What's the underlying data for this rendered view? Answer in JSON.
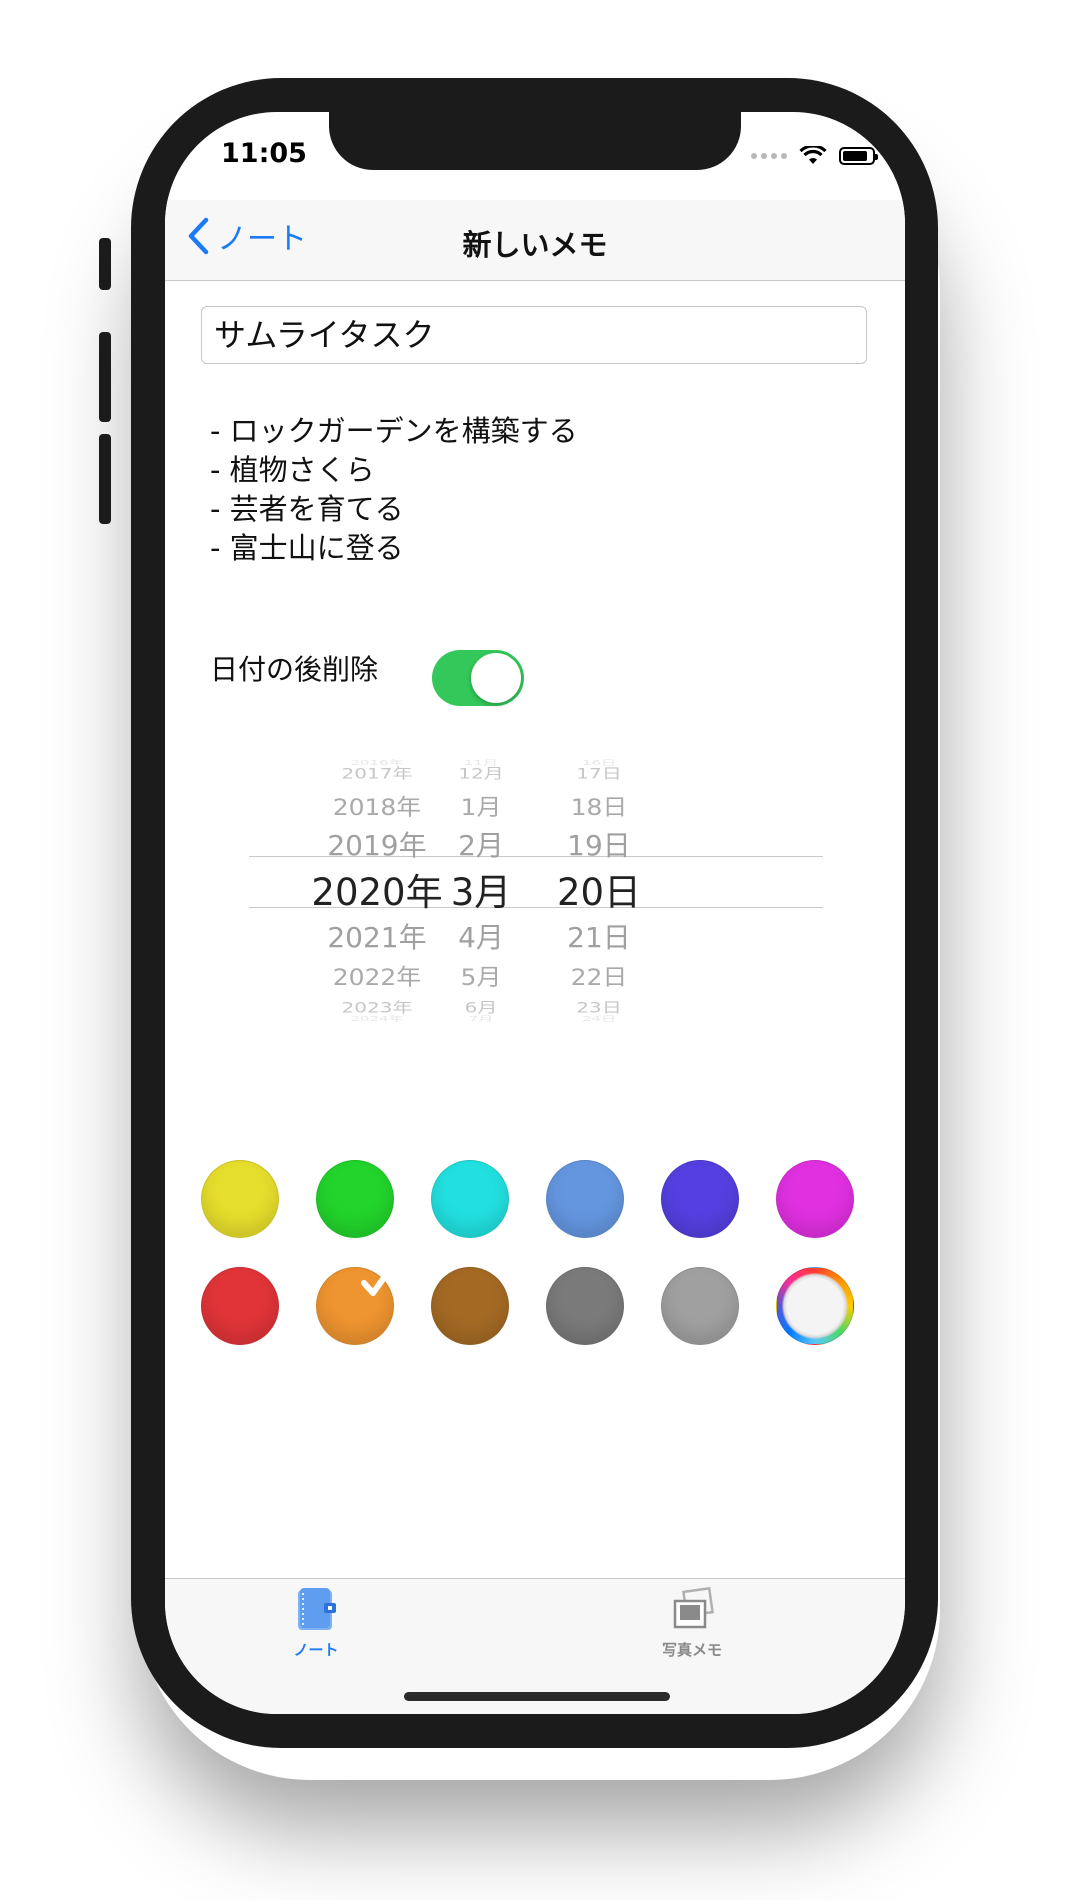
{
  "status": {
    "time": "11:05"
  },
  "nav": {
    "back_label": "ノート",
    "title": "新しいメモ"
  },
  "memo": {
    "title_value": "サムライタスク",
    "lines": [
      "- ロックガーデンを構築する",
      "- 植物さくら",
      "- 芸者を育てる",
      "- 富士山に登る"
    ]
  },
  "toggle": {
    "label": "日付の後削除",
    "on": true
  },
  "date_picker": {
    "years": [
      "2016年",
      "2017年",
      "2018年",
      "2019年",
      "2020年",
      "2021年",
      "2022年",
      "2023年",
      "2024年"
    ],
    "months": [
      "11月",
      "12月",
      "1月",
      "2月",
      "3月",
      "4月",
      "5月",
      "6月",
      "7月"
    ],
    "days": [
      "16日",
      "17日",
      "18日",
      "19日",
      "20日",
      "21日",
      "22日",
      "23日",
      "24日"
    ],
    "selected": {
      "year": "2020年",
      "month": "3月",
      "day": "20日"
    }
  },
  "colors": {
    "swatches": [
      {
        "name": "yellow",
        "color": "#e6de2c"
      },
      {
        "name": "green",
        "color": "#22d42b"
      },
      {
        "name": "cyan",
        "color": "#22e0e0"
      },
      {
        "name": "light-blue",
        "color": "#6496e0"
      },
      {
        "name": "indigo",
        "color": "#5440e0"
      },
      {
        "name": "magenta",
        "color": "#e030e0"
      },
      {
        "name": "red",
        "color": "#e03438"
      },
      {
        "name": "orange",
        "color": "#ee9430"
      },
      {
        "name": "brown",
        "color": "#a46a24"
      },
      {
        "name": "dark-gray",
        "color": "#7a7a7a"
      },
      {
        "name": "gray",
        "color": "#a0a0a0"
      },
      {
        "name": "custom-color-wheel",
        "color": "rainbow"
      }
    ],
    "selected": "orange",
    "accent": "#1a7cf5",
    "toggle_on": "#34c759"
  },
  "tabs": [
    {
      "label": "ノート",
      "icon": "notebook-icon",
      "active": true
    },
    {
      "label": "写真メモ",
      "icon": "photos-icon",
      "active": false
    }
  ]
}
